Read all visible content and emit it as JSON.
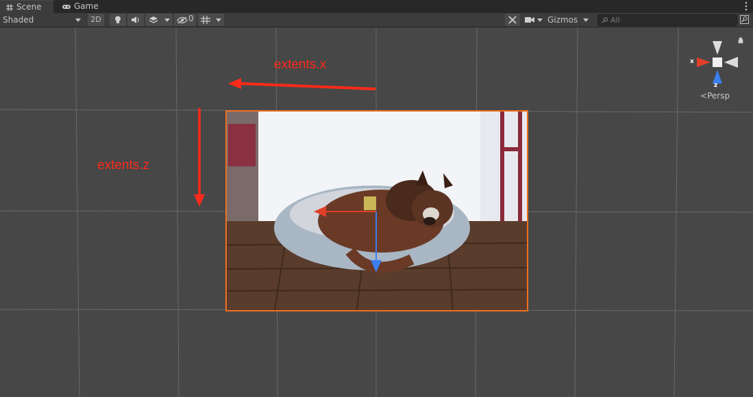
{
  "tabs": [
    {
      "label": "Scene",
      "icon": "grid-icon",
      "active": true
    },
    {
      "label": "Game",
      "icon": "gamepad-icon",
      "active": false
    }
  ],
  "toolbar": {
    "draw_mode": "Shaded",
    "mode_2d": "2D",
    "hidden_count": "0",
    "gizmos": "Gizmos",
    "search_placeholder": "All"
  },
  "annotations": {
    "extents_x": "extents.x",
    "extents_z": "extents.z"
  },
  "gizmo": {
    "x_label": "x",
    "z_label": "z",
    "projection": "Persp"
  },
  "colors": {
    "annotation": "#ff2a1a",
    "selection_outline": "#f07020",
    "x_axis": "#e0402a",
    "z_axis": "#3a7ff0"
  }
}
